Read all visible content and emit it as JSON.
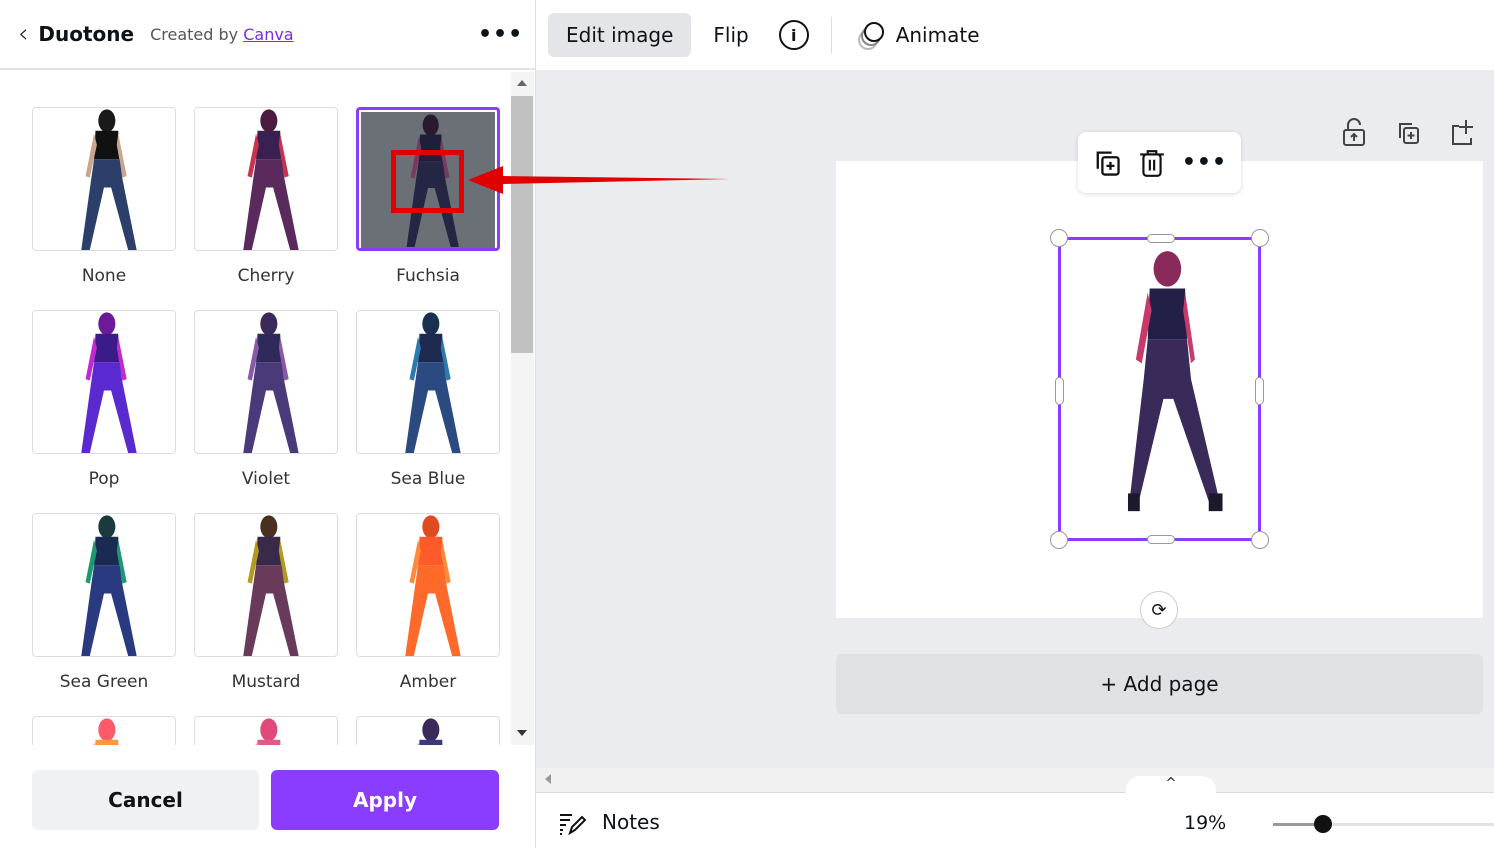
{
  "panel": {
    "title": "Duotone",
    "created_by": "Created by",
    "creator": "Canva",
    "more": "•••"
  },
  "presets": [
    {
      "label": "None",
      "skin": "#c9a48e",
      "top": "#111111",
      "legs": "#2c3f6b",
      "hair": "#1a1a1a"
    },
    {
      "label": "Cherry",
      "skin": "#c8344f",
      "top": "#3a2050",
      "legs": "#5a2a5c",
      "hair": "#4a1a40"
    },
    {
      "label": "Fuchsia",
      "skin": "#7a3a60",
      "top": "#1f1f3a",
      "legs": "#252544",
      "hair": "#2a1a30",
      "selected": true
    },
    {
      "label": "Pop",
      "skin": "#c02ad0",
      "top": "#3b1a8a",
      "legs": "#5a2ad0",
      "hair": "#6a1a9a"
    },
    {
      "label": "Violet",
      "skin": "#8a5aa8",
      "top": "#2f2a5a",
      "legs": "#4a3a7a",
      "hair": "#3a2a5a"
    },
    {
      "label": "Sea Blue",
      "skin": "#2a7ab0",
      "top": "#1f2a50",
      "legs": "#2a4a80",
      "hair": "#1a3050"
    },
    {
      "label": "Sea Green",
      "skin": "#1a9a70",
      "top": "#1a2a50",
      "legs": "#2a3a80",
      "hair": "#1a3a40"
    },
    {
      "label": "Mustard",
      "skin": "#b09a20",
      "top": "#3a2a4a",
      "legs": "#6a3a5a",
      "hair": "#4a3020"
    },
    {
      "label": "Amber",
      "skin": "#ff8a3a",
      "top": "#ff5a2a",
      "legs": "#ff6a2a",
      "hair": "#e04a20"
    },
    {
      "label": "",
      "skin": "#ff7a5a",
      "top": "#ff9a3a",
      "legs": "#ff7a5a",
      "hair": "#ff5a6a"
    },
    {
      "label": "",
      "skin": "#ff6a9a",
      "top": "#e05a8a",
      "legs": "#ff6a9a",
      "hair": "#e04a7a"
    },
    {
      "label": "",
      "skin": "#6a9ad0",
      "top": "#3a3a7a",
      "legs": "#4a4a9a",
      "hair": "#3a2a5a"
    }
  ],
  "actions": {
    "cancel": "Cancel",
    "apply": "Apply"
  },
  "toolbar": {
    "edit_image": "Edit image",
    "flip": "Flip",
    "animate": "Animate"
  },
  "canvas": {
    "add_page": "+ Add page"
  },
  "footer": {
    "notes": "Notes",
    "zoom": "19%",
    "zoom_value": 19
  },
  "colors": {
    "accent": "#8b3dff",
    "annotation": "#e00000"
  }
}
